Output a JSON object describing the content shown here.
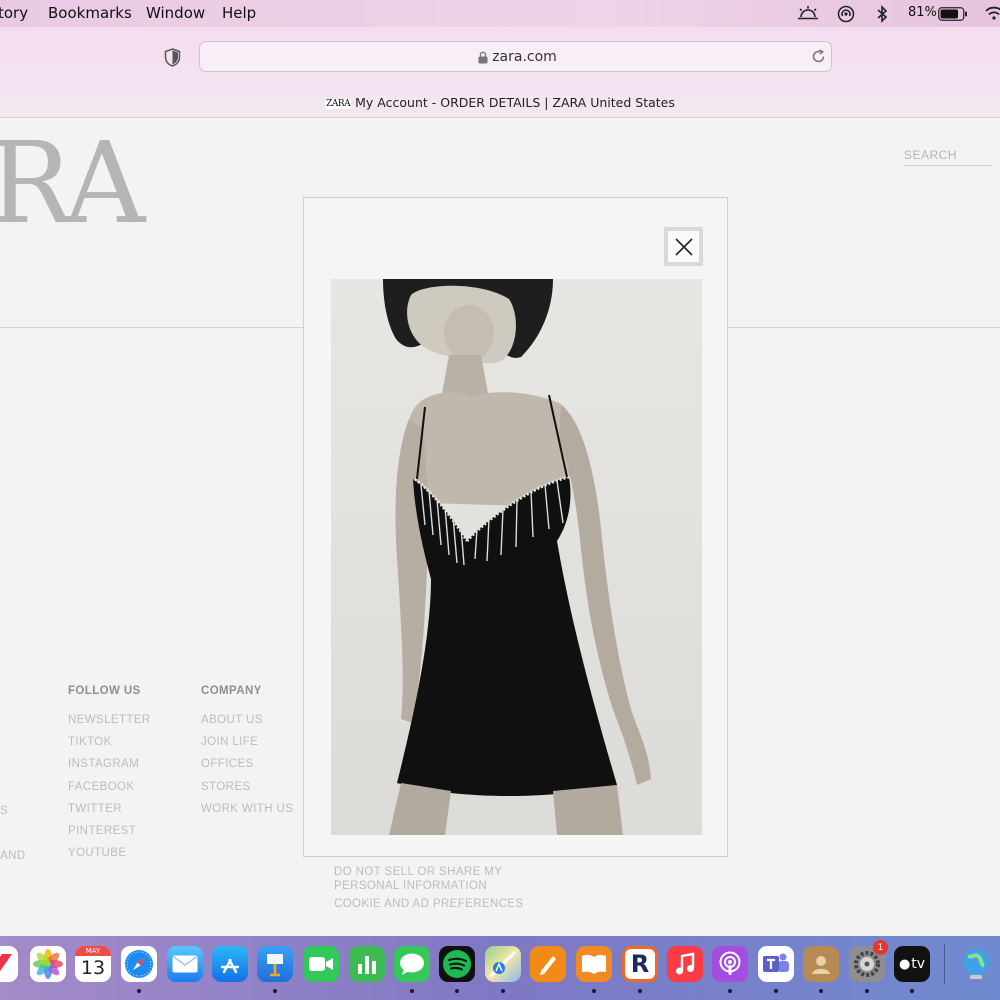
{
  "menubar": {
    "items": [
      "tory",
      "Bookmarks",
      "Window",
      "Help"
    ],
    "battery": "81%"
  },
  "browser": {
    "url": "zara.com",
    "tab_title": "My Account - ORDER DETAILS | ZARA United States"
  },
  "page": {
    "logo": "RA",
    "search_label": "SEARCH",
    "footer": {
      "follow_us": {
        "title": "FOLLOW US",
        "links": [
          "NEWSLETTER",
          "TIKTOK",
          "INSTAGRAM",
          "FACEBOOK",
          "TWITTER",
          "PINTEREST",
          "YOUTUBE"
        ]
      },
      "company": {
        "title": "COMPANY",
        "links": [
          "ABOUT US",
          "JOIN LIFE",
          "OFFICES",
          "STORES",
          "WORK WITH US"
        ]
      },
      "left_fragments": [
        "S",
        "AND"
      ],
      "privacy": [
        "DO NOT SELL OR SHARE MY",
        "PERSONAL INFORMATION"
      ],
      "cookie": "COOKIE AND AD PREFERENCES"
    }
  },
  "modal": {
    "close_icon": "close-icon",
    "image": "model-black-mini-dress-photo"
  },
  "dock": {
    "calendar_month": "MAY",
    "calendar_day": "13",
    "notification_badge": "1",
    "tv_label": "tv",
    "colors": {
      "facetime": "#32c85a",
      "numbers": "#3dbb52",
      "messages": "#34c759",
      "spotify": "#1db954",
      "pages": "#f28b16",
      "books": "#f08a24",
      "music": "#fc3c44",
      "podcasts": "#a34ee0",
      "teams": "#5b5fc7"
    }
  }
}
